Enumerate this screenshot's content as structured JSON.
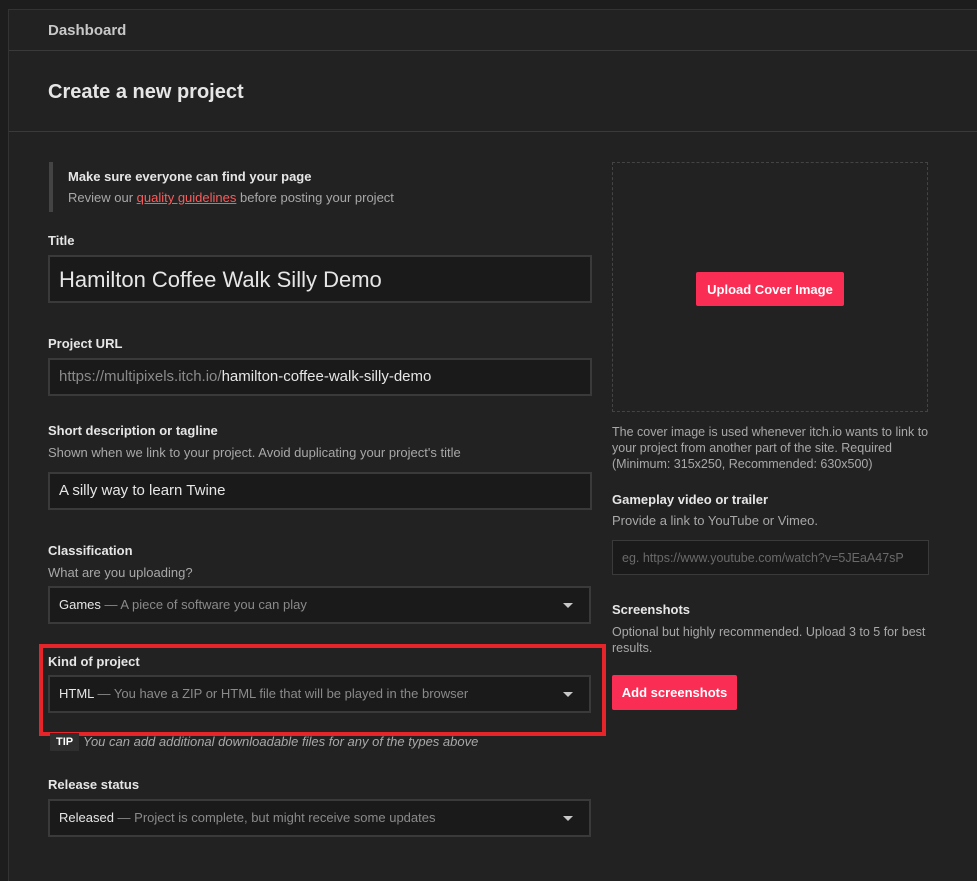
{
  "breadcrumb": "Dashboard",
  "page_title": "Create a new project",
  "notice": {
    "title": "Make sure everyone can find your page",
    "pre": "Review our ",
    "link": "quality guidelines",
    "post": " before posting your project"
  },
  "title_field": {
    "label": "Title",
    "value": "Hamilton Coffee Walk Silly Demo"
  },
  "url_field": {
    "label": "Project URL",
    "prefix": "https://multipixels.itch.io/",
    "value": "hamilton-coffee-walk-silly-demo"
  },
  "tagline_field": {
    "label": "Short description or tagline",
    "help": "Shown when we link to your project. Avoid duplicating your project's title",
    "value": "A silly way to learn Twine"
  },
  "classification": {
    "label": "Classification",
    "help": "What are you uploading?",
    "selected": "Games",
    "desc": " — A piece of software you can play"
  },
  "kind": {
    "label": "Kind of project",
    "selected": "HTML",
    "desc": " — You have a ZIP or HTML file that will be played in the browser"
  },
  "tip": {
    "badge": "TIP",
    "text": "You can add additional downloadable files for any of the types above"
  },
  "release": {
    "label": "Release status",
    "selected": "Released",
    "desc": " — Project is complete, but might receive some updates"
  },
  "cover": {
    "button": "Upload Cover Image",
    "help": "The cover image is used whenever itch.io wants to link to your project from another part of the site. Required (Minimum: 315x250, Recommended: 630x500)"
  },
  "video": {
    "label": "Gameplay video or trailer",
    "help": "Provide a link to YouTube or Vimeo.",
    "placeholder": "eg. https://www.youtube.com/watch?v=5JEaA47sP"
  },
  "screenshots": {
    "label": "Screenshots",
    "help": "Optional but highly recommended. Upload 3 to 5 for best results.",
    "button": "Add screenshots"
  },
  "colors": {
    "accent": "#fa2d55",
    "highlight": "#e5252a",
    "link": "#fa5c5c"
  }
}
